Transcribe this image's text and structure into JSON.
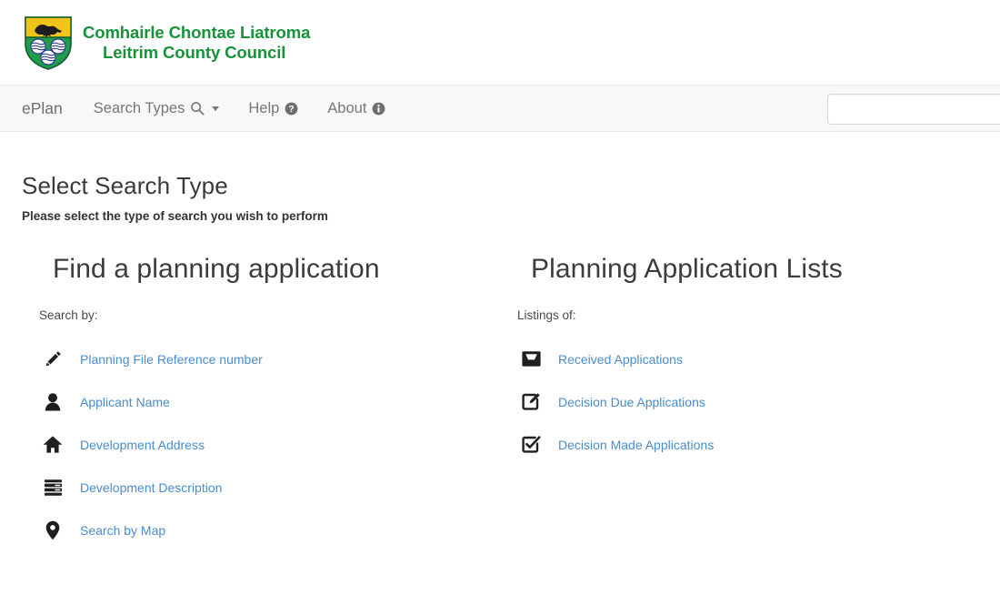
{
  "brand": {
    "line1": "Comhairle Chontae Liatroma",
    "line2": "Leitrim County Council",
    "logo_icon": "leitrim-county-crest-icon",
    "green": "#17923b",
    "crest_gold": "#f0c419",
    "crest_green": "#1f9d4d"
  },
  "nav": {
    "items": [
      {
        "label": "ePlan",
        "icon": null
      },
      {
        "label": "Search Types",
        "icon": "search-icon",
        "caret": true
      },
      {
        "label": "Help",
        "icon": "question-circle-icon"
      },
      {
        "label": "About",
        "icon": "info-circle-icon"
      }
    ],
    "search": {
      "value": "",
      "placeholder": ""
    }
  },
  "page": {
    "title": "Select Search Type",
    "subtitle": "Please select the type of search you wish to perform"
  },
  "columns": [
    {
      "heading": "Find a planning application",
      "sub": "Search by:",
      "items": [
        {
          "label": "Planning File Reference number",
          "icon": "pencil-icon"
        },
        {
          "label": "Applicant Name",
          "icon": "user-icon"
        },
        {
          "label": "Development Address",
          "icon": "home-icon"
        },
        {
          "label": "Development Description",
          "icon": "server-list-icon"
        },
        {
          "label": "Search by Map",
          "icon": "map-pin-icon"
        }
      ]
    },
    {
      "heading": "Planning Application Lists",
      "sub": "Listings of:",
      "items": [
        {
          "label": "Received Applications",
          "icon": "inbox-icon"
        },
        {
          "label": "Decision Due Applications",
          "icon": "edit-square-icon"
        },
        {
          "label": "Decision Made Applications",
          "icon": "check-square-icon"
        }
      ]
    }
  ],
  "colors": {
    "link": "#4a8ccc",
    "nav_text": "#777777",
    "nav_bg": "#f8f8f8",
    "icon": "#1f1f1f"
  }
}
